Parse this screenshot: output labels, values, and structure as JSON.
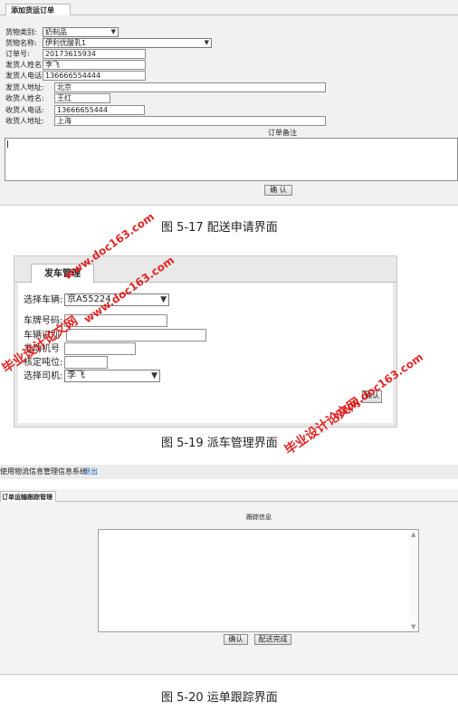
{
  "panel1": {
    "tab": "添加货运订单",
    "fields": [
      {
        "label": "货物类别:",
        "value": "奶制品",
        "type": "select"
      },
      {
        "label": "货物名称:",
        "value": "伊利优酸乳1",
        "type": "select"
      },
      {
        "label": "订单号:",
        "value": "20173615934",
        "type": "input"
      },
      {
        "label": "发货人姓名:",
        "value": "李飞",
        "type": "input"
      },
      {
        "label": "发货人电话:",
        "value": "136666554444",
        "type": "input"
      },
      {
        "label": "发货人地址:",
        "value": "北京",
        "type": "input"
      },
      {
        "label": "收货人姓名:",
        "value": "王红",
        "type": "input"
      },
      {
        "label": "收货人电话:",
        "value": "13666655444",
        "type": "input"
      },
      {
        "label": "收货人地址:",
        "value": "上海",
        "type": "input"
      }
    ],
    "remark_label": "订单备注",
    "confirm": "确 认"
  },
  "caption1": "图 5-17  配送申请界面",
  "panel2": {
    "tab": "发车管理",
    "vehicle_label": "选择车辆:",
    "vehicle_value": "京A55224",
    "plate_label": "车牌号码:",
    "vin_label": "车辆识别",
    "num_label": "发动机号",
    "seat_label": "核定吨位:",
    "driver_label": "选择司机:",
    "driver_value": "李飞",
    "submit": "确认"
  },
  "caption2": "图 5-19  派车管理界面",
  "panel3": {
    "system_title": "使用物流信息管理信息系统",
    "logout": "退出",
    "tab": "订单运输跟踪管理",
    "track_label": "跟踪信息",
    "confirm": "确认",
    "finish": "配送完成"
  },
  "caption3": "图 5-20  运单跟踪界面",
  "watermark": {
    "site": "www.doc163.com",
    "name": "毕业设计论文网"
  },
  "colors": {
    "watermark": "#e01010",
    "panel_bg": "#f1f1f1",
    "link": "#1a5fb4"
  }
}
